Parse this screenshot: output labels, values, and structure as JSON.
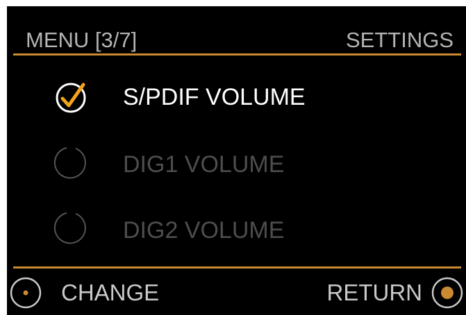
{
  "header": {
    "menu_position": "MENU [3/7]",
    "section_title": "SETTINGS"
  },
  "menu": {
    "items": [
      {
        "label": "S/PDIF VOLUME",
        "selected": true,
        "icon": "check-circle-icon"
      },
      {
        "label": "DIG1 VOLUME",
        "selected": false,
        "icon": "radio-empty-icon"
      },
      {
        "label": "DIG2 VOLUME",
        "selected": false,
        "icon": "radio-empty-icon"
      }
    ]
  },
  "footer": {
    "change_label": "CHANGE",
    "return_label": "RETURN",
    "change_icon": "knob-ring-icon",
    "return_icon": "knob-filled-icon"
  },
  "colors": {
    "background": "#000000",
    "accent": "#c98a32",
    "active_text": "#ffffff",
    "inactive_text": "#4d4d4d",
    "header_text": "#b4b4b4"
  }
}
